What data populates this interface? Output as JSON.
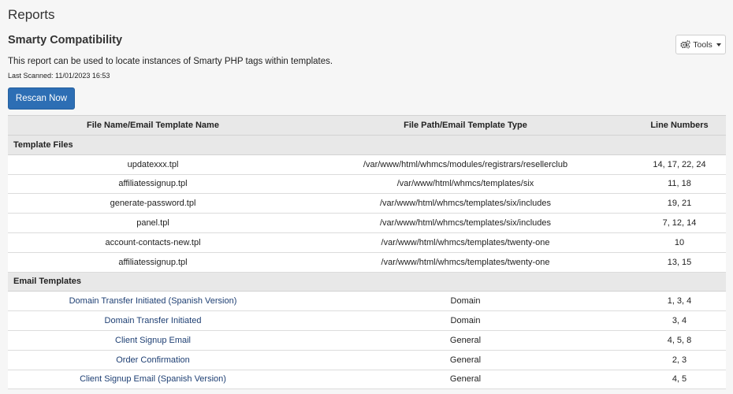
{
  "page": {
    "title": "Reports",
    "section_title": "Smarty Compatibility",
    "description": "This report can be used to locate instances of Smarty PHP tags within templates.",
    "last_scanned": "Last Scanned: 11/01/2023 16:53"
  },
  "toolbar": {
    "tools_label": "Tools",
    "tools_icon": "gears-icon",
    "rescan_label": "Rescan Now"
  },
  "table": {
    "headers": [
      "File Name/Email Template Name",
      "File Path/Email Template Type",
      "Line Numbers"
    ],
    "template_group_label": "Template Files",
    "template_files": [
      {
        "name": "updatexxx.tpl",
        "path": "/var/www/html/whmcs/modules/registrars/resellerclub",
        "lines": "14, 17, 22, 24"
      },
      {
        "name": "affiliatessignup.tpl",
        "path": "/var/www/html/whmcs/templates/six",
        "lines": "11, 18"
      },
      {
        "name": "generate-password.tpl",
        "path": "/var/www/html/whmcs/templates/six/includes",
        "lines": "19, 21"
      },
      {
        "name": "panel.tpl",
        "path": "/var/www/html/whmcs/templates/six/includes",
        "lines": "7, 12, 14"
      },
      {
        "name": "account-contacts-new.tpl",
        "path": "/var/www/html/whmcs/templates/twenty-one",
        "lines": "10"
      },
      {
        "name": "affiliatessignup.tpl",
        "path": "/var/www/html/whmcs/templates/twenty-one",
        "lines": "13, 15"
      }
    ],
    "email_group_label": "Email Templates",
    "email_templates": [
      {
        "name": "Domain Transfer Initiated (Spanish Version)",
        "type": "Domain",
        "lines": "1, 3, 4"
      },
      {
        "name": "Domain Transfer Initiated",
        "type": "Domain",
        "lines": "3, 4"
      },
      {
        "name": "Client Signup Email",
        "type": "General",
        "lines": "4, 5, 8"
      },
      {
        "name": "Order Confirmation",
        "type": "General",
        "lines": "2, 3"
      },
      {
        "name": "Client Signup Email (Spanish Version)",
        "type": "General",
        "lines": "4, 5"
      }
    ]
  }
}
